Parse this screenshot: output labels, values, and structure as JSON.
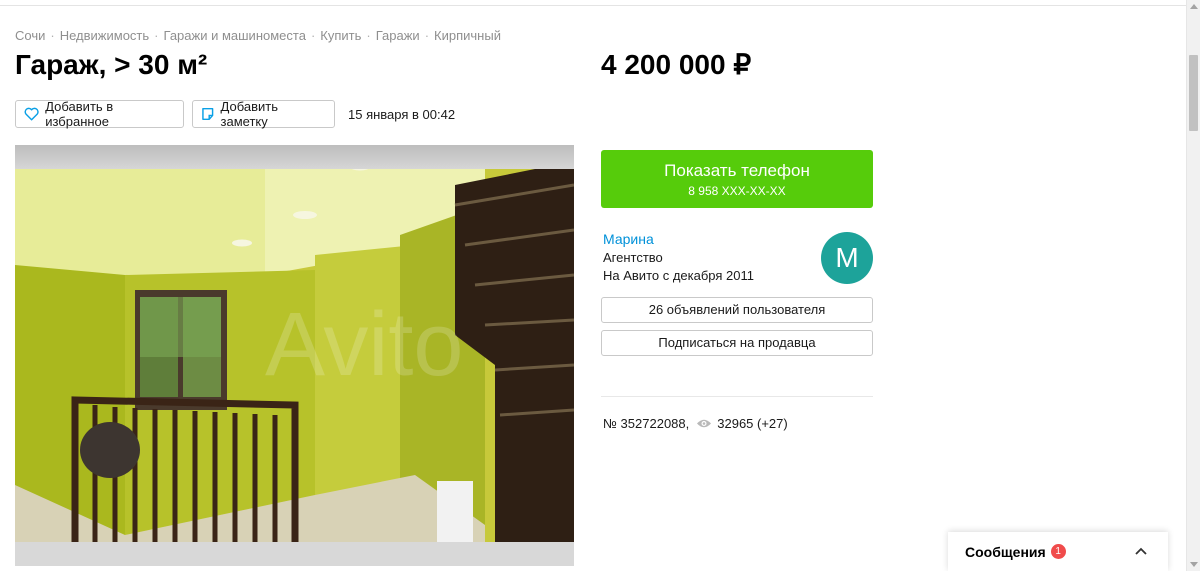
{
  "breadcrumbs": [
    "Сочи",
    "Недвижимость",
    "Гаражи и машиноместа",
    "Купить",
    "Гаражи",
    "Кирпичный"
  ],
  "title": "Гараж, > 30 м²",
  "price": "4 200 000 ₽",
  "actions": {
    "favorite_label": "Добавить в избранное",
    "note_label": "Добавить заметку",
    "date": "15 января в 00:42"
  },
  "phone": {
    "label": "Показать телефон",
    "number": "8 958 XXX-XX-XX",
    "color": "#56cc0b"
  },
  "seller": {
    "name": "Марина",
    "type": "Агентство",
    "since": "На Авито с декабря 2011",
    "avatar_letter": "М",
    "avatar_color": "#1da39a",
    "ads_label": "26 объявлений пользователя",
    "subscribe_label": "Подписаться на продавца"
  },
  "listing": {
    "number": "№ 352722088,",
    "views": "32965 (+27)"
  },
  "messages": {
    "label": "Сообщения",
    "count": "1"
  },
  "gallery": {
    "watermark": "Avito"
  },
  "icons": [
    "heart-icon",
    "note-icon",
    "eye-icon",
    "chevron-up-icon"
  ]
}
